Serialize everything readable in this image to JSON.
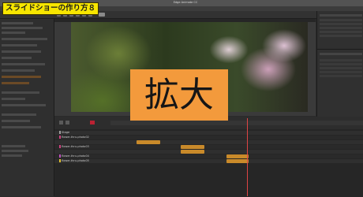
{
  "window": {
    "title": "Edge Animate CC"
  },
  "caption": {
    "text": "スライドショーの作り方８"
  },
  "overlay": {
    "text": "拡大"
  },
  "timeline": {
    "tracks": [
      {
        "label": "Stage",
        "color": "#9e9e9e"
      },
      {
        "label": "flower-thru-photo02",
        "color": "#d04080"
      },
      {
        "label": "flower-thru-photo03",
        "color": "#d04080"
      },
      {
        "label": "flower-thru-photo04",
        "color": "#c050c0"
      },
      {
        "label": "flower-thru-photo05",
        "color": "#e0c030"
      }
    ]
  },
  "colors": {
    "caption_bg": "#f7e600",
    "overlay_bg": "#f39a3c",
    "playhead": "#dd4444"
  }
}
